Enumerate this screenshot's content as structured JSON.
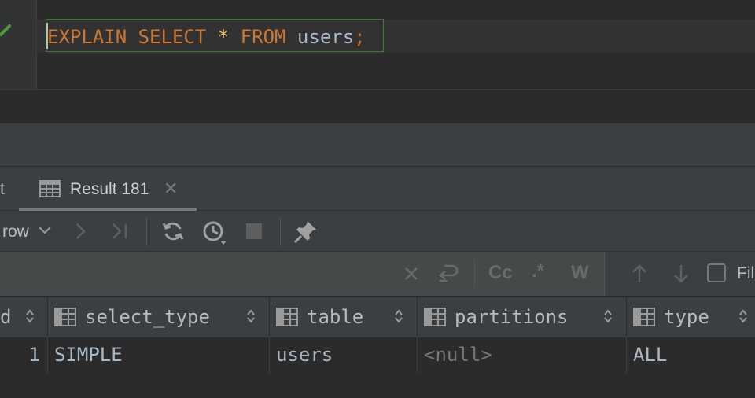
{
  "editor": {
    "code_tokens": [
      "EXPLAIN",
      "SELECT",
      "*",
      "FROM",
      "users",
      ";"
    ]
  },
  "tabs": {
    "prev_tab_partial": "t",
    "active_tab": "Result 181"
  },
  "toolbar": {
    "row_label": "row"
  },
  "search": {
    "options": [
      "Cc",
      ".*",
      "W"
    ],
    "filter_label": "Fil"
  },
  "grid": {
    "columns": [
      "d",
      "select_type",
      "table",
      "partitions",
      "type"
    ],
    "rows": [
      [
        "1",
        "SIMPLE",
        "users",
        "<null>",
        "ALL"
      ]
    ]
  },
  "icons": {
    "check": "check-icon",
    "table": "table-icon",
    "close": "close-icon",
    "next": "next-page-icon",
    "last": "last-page-icon",
    "reload": "reload-icon",
    "history": "history-icon",
    "stop": "stop-icon",
    "pin": "pin-icon",
    "clear": "clear-search-icon",
    "newline": "newline-icon",
    "up": "arrow-up-icon",
    "down": "arrow-down-icon",
    "column": "column-icon",
    "sort": "sort-icon"
  },
  "colors": {
    "keyword": "#cc7832",
    "operator": "#ffc66d",
    "identifier": "#a9b7c6",
    "statement_border": "#3e7a2f",
    "null_text": "#767676"
  }
}
